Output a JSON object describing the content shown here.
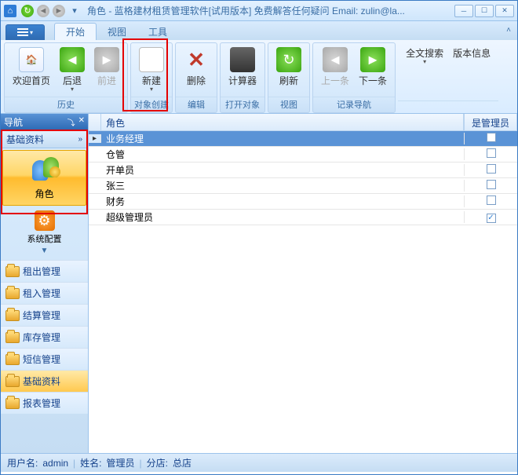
{
  "titlebar": {
    "title": "角色 - 蓝格建材租赁管理软件[试用版本] 免费解答任何疑问 Email: zulin@la..."
  },
  "tabs": {
    "start": "开始",
    "view": "视图",
    "tools": "工具"
  },
  "ribbon": {
    "history": {
      "caption": "历史",
      "welcome": "欢迎首页",
      "back": "后退",
      "forward": "前进"
    },
    "create": {
      "caption": "对象创建",
      "new": "新建"
    },
    "edit": {
      "caption": "编辑",
      "delete": "删除"
    },
    "open": {
      "caption": "打开对象",
      "calc": "计算器"
    },
    "view": {
      "caption": "视图",
      "refresh": "刷新"
    },
    "recnav": {
      "caption": "记录导航",
      "prev": "上一条",
      "next": "下一条"
    },
    "fulltext": "全文搜索",
    "version": "版本信息"
  },
  "nav": {
    "title": "导航",
    "section": "基础资料",
    "active_item": "角色",
    "gear_item": "系统配置",
    "items": [
      {
        "label": "租出管理"
      },
      {
        "label": "租入管理"
      },
      {
        "label": "结算管理"
      },
      {
        "label": "库存管理"
      },
      {
        "label": "短信管理"
      },
      {
        "label": "基础资料"
      },
      {
        "label": "报表管理"
      }
    ]
  },
  "grid": {
    "col_role": "角色",
    "col_admin": "是管理员",
    "rows": [
      {
        "name": "业务经理",
        "admin": false,
        "selected": true
      },
      {
        "name": "仓管",
        "admin": false,
        "selected": false
      },
      {
        "name": "开单员",
        "admin": false,
        "selected": false
      },
      {
        "name": "张三",
        "admin": false,
        "selected": false
      },
      {
        "name": "财务",
        "admin": false,
        "selected": false
      },
      {
        "name": "超级管理员",
        "admin": true,
        "selected": false
      }
    ]
  },
  "status": {
    "user_label": "用户名:",
    "user_value": "admin",
    "name_label": "姓名:",
    "name_value": "管理员",
    "branch_label": "分店:",
    "branch_value": "总店"
  }
}
